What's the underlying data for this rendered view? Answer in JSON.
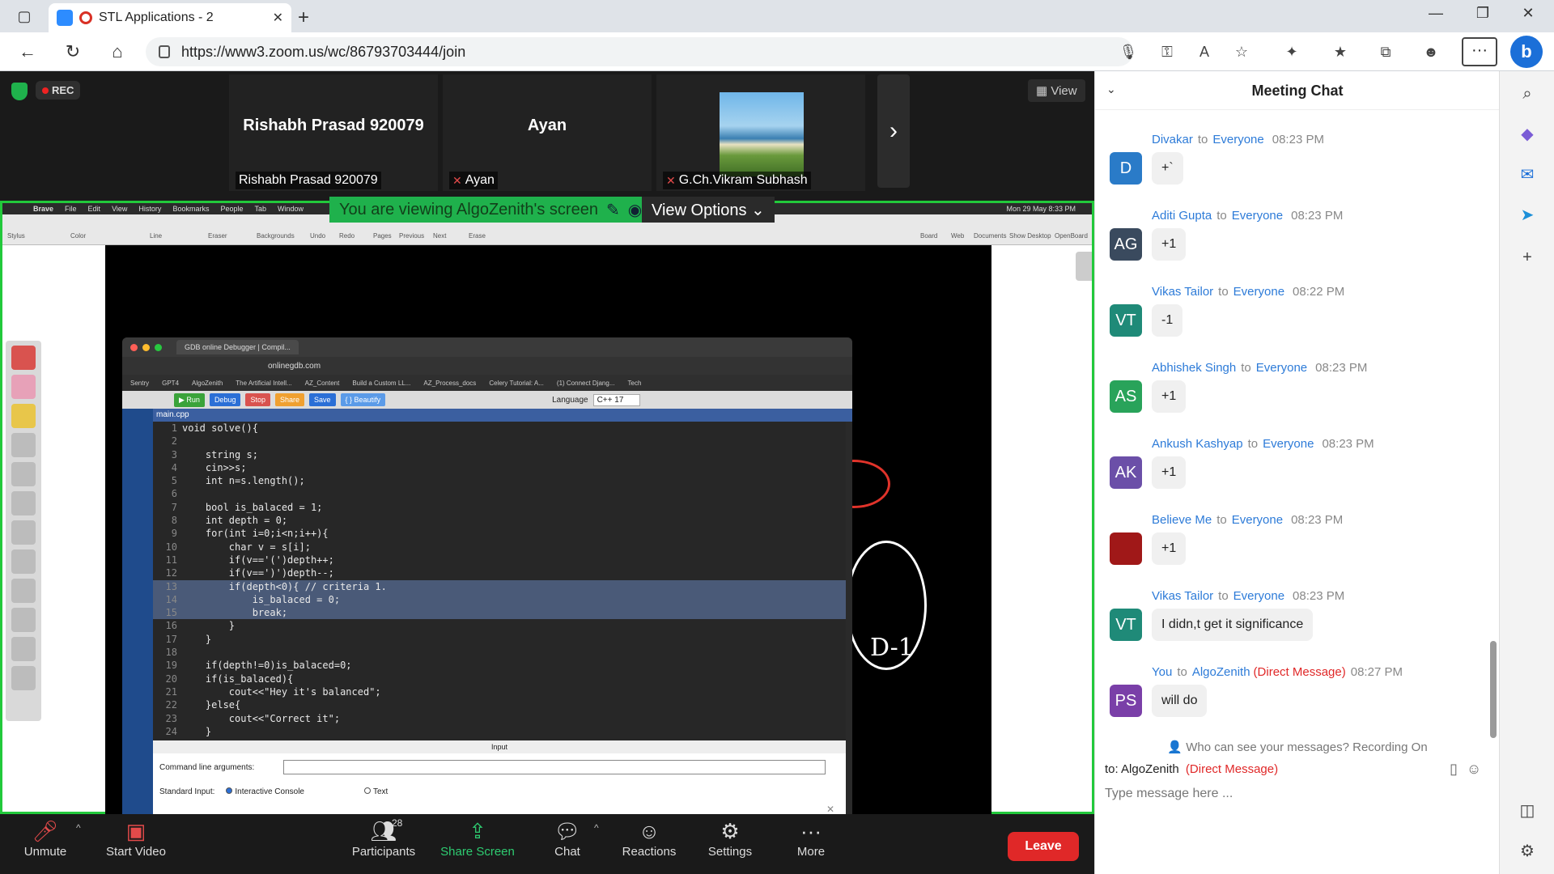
{
  "browser": {
    "tab_title": "STL Applications - 2",
    "url": "https://www3.zoom.us/wc/86793703444/join"
  },
  "zoom": {
    "rec_label": "REC",
    "view_label": "View",
    "tiles": [
      {
        "big_name": "Rishabh Prasad 920079",
        "label": "Rishabh Prasad 920079",
        "muted": false
      },
      {
        "big_name": "Ayan",
        "label": "Ayan",
        "muted": true
      },
      {
        "big_name": "",
        "label": "G.Ch.Vikram Subhash",
        "muted": true
      }
    ],
    "share_banner": "You are viewing AlgoZenith's screen",
    "view_options": "View Options",
    "controls": {
      "unmute": "Unmute",
      "start_video": "Start Video",
      "participants": "Participants",
      "participants_count": "28",
      "share_screen": "Share Screen",
      "chat": "Chat",
      "reactions": "Reactions",
      "settings": "Settings",
      "more": "More",
      "leave": "Leave"
    }
  },
  "shared_screen": {
    "mac_menu": [
      "Brave",
      "File",
      "Edit",
      "View",
      "History",
      "Bookmarks",
      "People",
      "Tab",
      "Window"
    ],
    "mac_clock": "Mon 29 May  8:33 PM",
    "draw_tools": [
      "Stylus",
      "Color",
      "Line",
      "Eraser",
      "Backgrounds",
      "Undo",
      "Redo",
      "Pages",
      "Previous",
      "Next",
      "Erase",
      "Board",
      "Web",
      "Documents",
      "Show Desktop",
      "OpenBoard"
    ],
    "code_window": {
      "tab_title": "GDB online Debugger | Compil...",
      "url": "onlinegdb.com",
      "bookmarks": [
        "Sentry",
        "GPT4",
        "AlgoZenith",
        "The Artificial Intell...",
        "AZ_Content",
        "Build a Custom LL...",
        "AZ_Process_docs",
        "Celery Tutorial: A...",
        "(1) Connect Djang...",
        "Tech"
      ],
      "toolbar": {
        "run": "Run",
        "debug": "Debug",
        "stop": "Stop",
        "share": "Share",
        "save": "Save",
        "beautify": "{ } Beautify",
        "language_label": "Language",
        "language_value": "C++ 17"
      },
      "file_tab": "main.cpp",
      "code_lines": [
        "void solve(){",
        "",
        "    string s;",
        "    cin>>s;",
        "    int n=s.length();",
        "",
        "    bool is_balaced = 1;",
        "    int depth = 0;",
        "    for(int i=0;i<n;i++){",
        "        char v = s[i];",
        "        if(v=='(')depth++;",
        "        if(v==')')depth--;",
        "        if(depth<0){ // criteria 1.",
        "            is_balaced = 0;",
        "            break;",
        "        }",
        "    }",
        "",
        "    if(depth!=0)is_balaced=0;",
        "    if(is_balaced){",
        "        cout<<\"Hey it's balanced\";",
        "    }else{",
        "        cout<<\"Correct it\";",
        "    }"
      ],
      "highlighted_lines": [
        13,
        14,
        15
      ],
      "input_panel": {
        "header": "Input",
        "cmd_label": "Command line arguments:",
        "std_label": "Standard Input:",
        "opt_console": "Interactive Console",
        "opt_text": "Text"
      }
    },
    "ink_text": "D-1"
  },
  "chat": {
    "title": "Meeting Chat",
    "messages": [
      {
        "sender": "Divakar",
        "to": "to",
        "recipient": "Everyone",
        "dm": "",
        "time": "08:23 PM",
        "initials": "D",
        "avatar_color": "#2a7bc8",
        "text": "+`"
      },
      {
        "sender": "Aditi Gupta",
        "to": "to",
        "recipient": "Everyone",
        "dm": "",
        "time": "08:23 PM",
        "initials": "AG",
        "avatar_color": "#3a4a5e",
        "text": "+1"
      },
      {
        "sender": "Vikas Tailor",
        "to": "to",
        "recipient": "Everyone",
        "dm": "",
        "time": "08:22 PM",
        "initials": "VT",
        "avatar_color": "#1f8a78",
        "text": "-1"
      },
      {
        "sender": "Abhishek Singh",
        "to": "to",
        "recipient": "Everyone",
        "dm": "",
        "time": "08:23 PM",
        "initials": "AS",
        "avatar_color": "#29a35a",
        "text": "+1"
      },
      {
        "sender": "Ankush Kashyap",
        "to": "to",
        "recipient": "Everyone",
        "dm": "",
        "time": "08:23 PM",
        "initials": "AK",
        "avatar_color": "#6b4fa8",
        "text": "+1"
      },
      {
        "sender": "Believe Me",
        "to": "to",
        "recipient": "Everyone",
        "dm": "",
        "time": "08:23 PM",
        "initials": "",
        "avatar_color": "#a01818",
        "text": "+1"
      },
      {
        "sender": "Vikas Tailor",
        "to": "to",
        "recipient": "Everyone",
        "dm": "",
        "time": "08:23 PM",
        "initials": "VT",
        "avatar_color": "#1f8a78",
        "text": "I didn,t get it significance"
      },
      {
        "sender": "You",
        "to": "to",
        "recipient": "AlgoZenith",
        "dm": "(Direct Message)",
        "time": "08:27 PM",
        "initials": "PS",
        "avatar_color": "#7a3fa8",
        "text": "will do"
      }
    ],
    "privacy_note": "Who can see your messages? Recording On",
    "to_label": "to:",
    "to_recipient": "AlgoZenith",
    "to_dm": "(Direct Message)",
    "input_placeholder": "Type message here ..."
  },
  "colors": {
    "zoom_green": "#22c93b",
    "leave_red": "#e02828",
    "link_blue": "#2d7bd8"
  }
}
